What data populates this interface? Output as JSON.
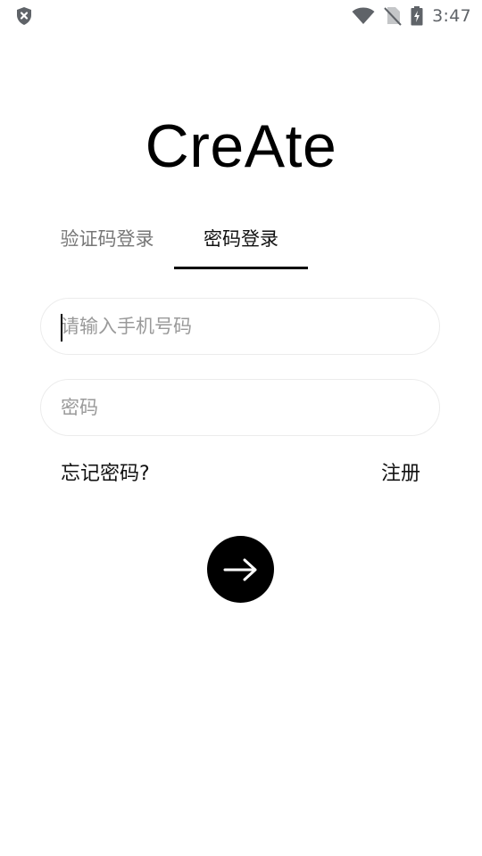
{
  "status_bar": {
    "time": "3:47",
    "icons": [
      "shield-x-icon",
      "wifi-icon",
      "no-sim-icon",
      "battery-charging-icon"
    ]
  },
  "app": {
    "title": "CreAte"
  },
  "tabs": [
    {
      "label": "验证码登录",
      "active": false
    },
    {
      "label": "密码登录",
      "active": true
    }
  ],
  "form": {
    "phone_placeholder": "请输入手机号码",
    "password_placeholder": "密码"
  },
  "links": {
    "forgot_password": "忘记密码?",
    "register": "注册"
  },
  "submit": {
    "icon": "arrow-right-icon",
    "background": "#000000"
  },
  "colors": {
    "accent": "#000000",
    "inactive_tab": "#777777",
    "placeholder": "#9a9a9a",
    "field_border": "#ececec",
    "status_icons": "#5f6368"
  }
}
